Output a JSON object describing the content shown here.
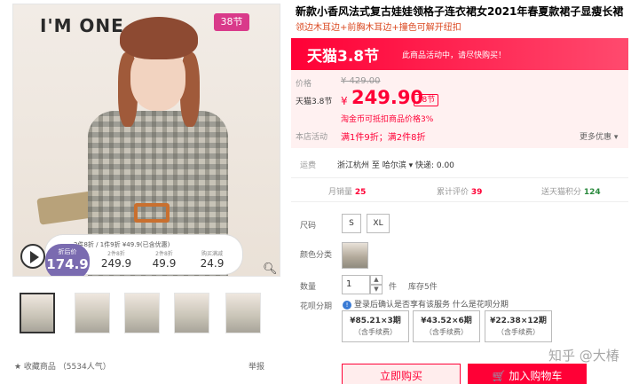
{
  "gallery": {
    "brand": "I'M ONE",
    "promo_badge": "38节",
    "overlay_banner": "2件8折 / 1件9折  ¥49.9(已含优惠)",
    "price_main_label": "折后价",
    "price_main": "174.9",
    "cells": [
      {
        "label": "2件8折",
        "value": "249.9"
      },
      {
        "label": "2件8折",
        "value": "49.9"
      },
      {
        "label": "购买满减",
        "value": "24.9"
      }
    ],
    "thumbnail_count": 5,
    "favorite": "★ 收藏商品 （5534人气）",
    "report": "举报"
  },
  "product": {
    "title": "新款小香风法式复古娃娃领格子连衣裙女2021年春夏款裙子显瘦长裙",
    "subtitle": "领边木耳边+前胸木耳边+撞色可解开纽扣"
  },
  "banner": {
    "logo": "天猫3.8节",
    "note": "此商品活动中，请尽快购买！"
  },
  "pricing": {
    "original_label": "价格",
    "original_price": "¥ 429.00",
    "current_label": "天猫3.8节",
    "currency": "¥",
    "current_price": "249.90",
    "tag": "38节",
    "coin_text": "淘金币可抵扣商品价格3%",
    "promo_label": "本店活动",
    "promo_text": "满1件9折；满2件8折",
    "more": "更多优惠 ▾"
  },
  "shipping": {
    "label": "运费",
    "text": "浙江杭州 至 哈尔滨 ▾  快递: 0.00"
  },
  "stats": {
    "monthly_label": "月销量",
    "monthly": "25",
    "reviews_label": "累计评价",
    "reviews": "39",
    "points_label": "送天猫积分",
    "points": "124"
  },
  "options": {
    "size_label": "尺码",
    "sizes": [
      "S",
      "XL"
    ],
    "color_label": "颜色分类",
    "qty_label": "数量",
    "qty_value": "1",
    "qty_unit": "件",
    "stock": "库存5件",
    "huabei_label": "花呗分期",
    "huabei_notice": "登录后确认是否享有该服务 什么是花呗分期",
    "huabei_plans": [
      {
        "amount": "¥85.21×3期",
        "fee": "（含手续费）"
      },
      {
        "amount": "¥43.52×6期",
        "fee": "（含手续费）"
      },
      {
        "amount": "¥22.38×12期",
        "fee": "（含手续费）"
      }
    ]
  },
  "actions": {
    "buy": "立即购买",
    "cart": "🛒 加入购物车"
  },
  "watermark": "知乎 @大椿"
}
